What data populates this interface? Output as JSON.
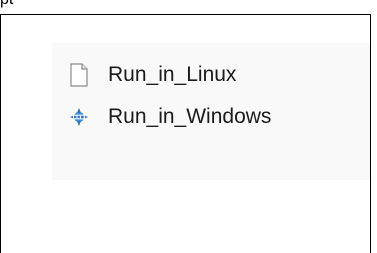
{
  "header": {
    "cropped_label": "pt"
  },
  "explorer": {
    "files": [
      {
        "label": "Run_in_Linux",
        "icon": "blank-file-icon"
      },
      {
        "label": "Run_in_Windows",
        "icon": "batch-file-icon"
      }
    ]
  },
  "colors": {
    "panel_background": "#f9f9f9",
    "border": "#000000",
    "text": "#1b1b1b"
  }
}
